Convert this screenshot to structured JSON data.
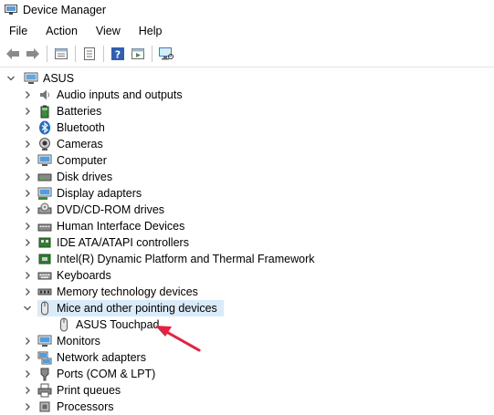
{
  "window": {
    "title": "Device Manager",
    "icon": "device-manager-icon"
  },
  "menu": [
    "File",
    "Action",
    "View",
    "Help"
  ],
  "toolbar": [
    "back-arrow-icon",
    "forward-arrow-icon",
    "properties-icon",
    "update-driver-icon",
    "help-icon",
    "show-hidden-icon",
    "scan-hardware-icon"
  ],
  "tree": {
    "root": {
      "label": "ASUS",
      "icon": "computer-icon",
      "expanded": true
    },
    "categories": [
      {
        "label": "Audio inputs and outputs",
        "icon": "speaker-icon"
      },
      {
        "label": "Batteries",
        "icon": "battery-icon"
      },
      {
        "label": "Bluetooth",
        "icon": "bluetooth-icon"
      },
      {
        "label": "Cameras",
        "icon": "camera-icon"
      },
      {
        "label": "Computer",
        "icon": "monitor-icon"
      },
      {
        "label": "Disk drives",
        "icon": "disk-drive-icon"
      },
      {
        "label": "Display adapters",
        "icon": "display-adapter-icon"
      },
      {
        "label": "DVD/CD-ROM drives",
        "icon": "dvd-drive-icon"
      },
      {
        "label": "Human Interface Devices",
        "icon": "hid-icon"
      },
      {
        "label": "IDE ATA/ATAPI controllers",
        "icon": "ide-controller-icon"
      },
      {
        "label": "Intel(R) Dynamic Platform and Thermal Framework",
        "icon": "chip-icon"
      },
      {
        "label": "Keyboards",
        "icon": "keyboard-icon"
      },
      {
        "label": "Memory technology devices",
        "icon": "memory-icon"
      },
      {
        "label": "Mice and other pointing devices",
        "icon": "mouse-icon",
        "expanded": true,
        "selected": true,
        "children": [
          {
            "label": "ASUS Touchpad",
            "icon": "mouse-icon"
          }
        ]
      },
      {
        "label": "Monitors",
        "icon": "monitor-icon"
      },
      {
        "label": "Network adapters",
        "icon": "network-icon"
      },
      {
        "label": "Ports (COM & LPT)",
        "icon": "port-icon"
      },
      {
        "label": "Print queues",
        "icon": "printer-icon"
      },
      {
        "label": "Processors",
        "icon": "processor-icon"
      }
    ]
  },
  "colors": {
    "selection": "#d9ebf9",
    "annotation_arrow": "#e8203f",
    "chevron": "#555555"
  }
}
